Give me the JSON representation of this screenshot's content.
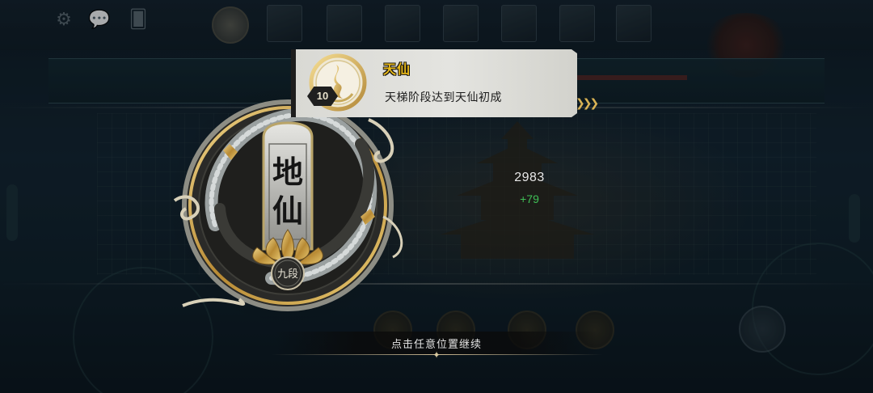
{
  "toast": {
    "title": "天仙",
    "description": "天梯阶段达到天仙初成",
    "level": "10"
  },
  "medal": {
    "rank_text": [
      "地",
      "仙"
    ],
    "tier": "九段"
  },
  "score": {
    "value": "2983",
    "delta": "+79"
  },
  "hint": "点击任意位置继续",
  "icons": {
    "settings": "gear-icon",
    "chat": "chat-bubble-icon",
    "cards": "cards-icon",
    "chevrons": "chevron-right-icon",
    "ornament": "lotus-icon"
  },
  "colors": {
    "title_gold": "#e8b91a",
    "delta_green": "#3fbf56",
    "medal_gold": "#c9a24a"
  }
}
